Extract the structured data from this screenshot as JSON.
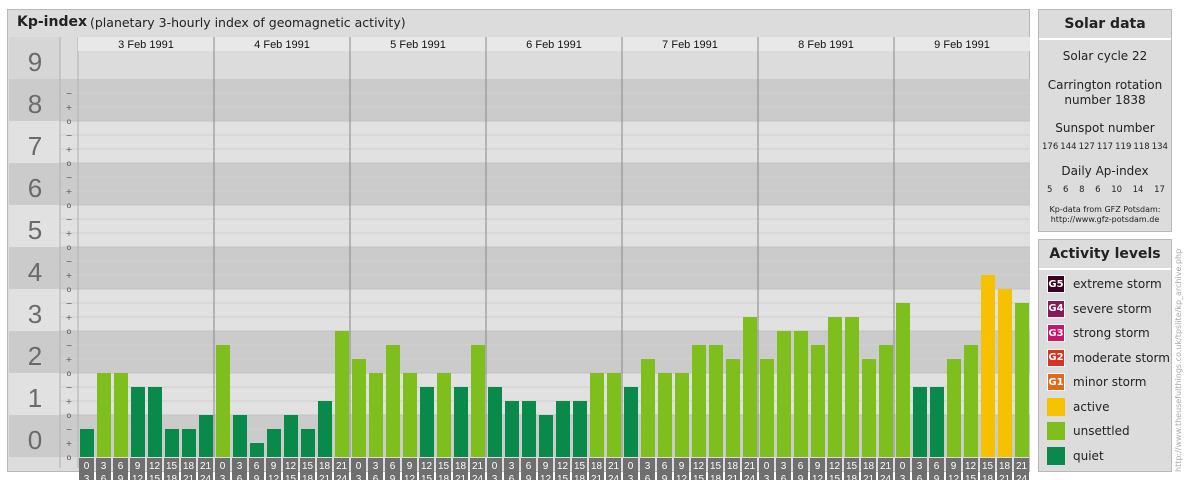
{
  "header": {
    "title": "Kp-index",
    "subtitle": "(planetary 3-hourly index of geomagnetic activity)"
  },
  "chart_data": {
    "type": "bar",
    "title": "Kp-index",
    "subtitle": "(planetary 3-hourly index of geomagnetic activity)",
    "ylim": [
      0,
      9
    ],
    "y_major_ticks": [
      "0",
      "1",
      "2",
      "3",
      "4",
      "5",
      "6",
      "7",
      "8",
      "9"
    ],
    "y_minor_labels": [
      "−",
      "o",
      "+"
    ],
    "grid": true,
    "legend_position": "right",
    "days": [
      "3 Feb 1991",
      "4 Feb 1991",
      "5 Feb 1991",
      "6 Feb 1991",
      "7 Feb 1991",
      "8 Feb 1991",
      "9 Feb 1991"
    ],
    "intervals": [
      {
        "start": "0",
        "end": "3"
      },
      {
        "start": "3",
        "end": "6"
      },
      {
        "start": "6",
        "end": "9"
      },
      {
        "start": "9",
        "end": "12"
      },
      {
        "start": "12",
        "end": "15"
      },
      {
        "start": "15",
        "end": "18"
      },
      {
        "start": "18",
        "end": "21"
      },
      {
        "start": "21",
        "end": "24"
      }
    ],
    "series": [
      {
        "values": [
          0.667,
          2.0,
          2.0,
          1.667,
          1.667,
          0.667,
          0.667,
          1.0,
          2.667,
          1.0,
          0.333,
          0.667,
          1.0,
          0.667,
          1.333,
          3.0,
          2.333,
          2.0,
          2.667,
          2.0,
          1.667,
          2.0,
          1.667,
          2.667,
          1.667,
          1.333,
          1.333,
          1.0,
          1.333,
          1.333,
          2.0,
          2.0,
          1.667,
          2.333,
          2.0,
          2.0,
          2.667,
          2.667,
          2.333,
          3.333,
          2.333,
          3.0,
          3.0,
          2.667,
          3.333,
          3.333,
          2.333,
          2.667,
          3.667,
          1.667,
          1.667,
          2.333,
          2.667,
          4.333,
          4.0,
          3.667
        ]
      }
    ],
    "colors": {
      "quiet": "#0a8a4a",
      "unsettled": "#7ebf1e",
      "active": "#f6c200",
      "G1": "#e06a1b",
      "G2": "#d7331f",
      "G3": "#c8156a",
      "G4": "#8a1a56",
      "G5": "#3d0020"
    }
  },
  "solar_data": {
    "title": "Solar data",
    "cycle_label": "Solar cycle 22",
    "carrington_line1": "Carrington rotation",
    "carrington_line2": "number 1838",
    "sunspot_label": "Sunspot number",
    "sunspot_numbers": [
      "176",
      "144",
      "127",
      "117",
      "119",
      "118",
      "134"
    ],
    "ap_label": "Daily Ap-index",
    "ap_values": [
      "5",
      "6",
      "8",
      "6",
      "10",
      "14",
      "17"
    ],
    "credit_line1": "Kp-data from GFZ Potsdam:",
    "credit_line2": "http://www.gfz-potsdam.de"
  },
  "activity_levels": {
    "title": "Activity levels",
    "items": [
      {
        "code": "G5",
        "label": "extreme storm",
        "color": "#3d0020"
      },
      {
        "code": "G4",
        "label": "severe storm",
        "color": "#8a1a56"
      },
      {
        "code": "G3",
        "label": "strong storm",
        "color": "#c8156a"
      },
      {
        "code": "G2",
        "label": "moderate storm",
        "color": "#d7331f"
      },
      {
        "code": "G1",
        "label": "minor storm",
        "color": "#e06a1b"
      },
      {
        "code": "",
        "label": "active",
        "color": "#f6c200"
      },
      {
        "code": "",
        "label": "unsettled",
        "color": "#7ebf1e"
      },
      {
        "code": "",
        "label": "quiet",
        "color": "#0a8a4a"
      }
    ]
  },
  "footer_credit": "http://www.theusefulthings.co.uk/tpslite/kp_archive.php"
}
